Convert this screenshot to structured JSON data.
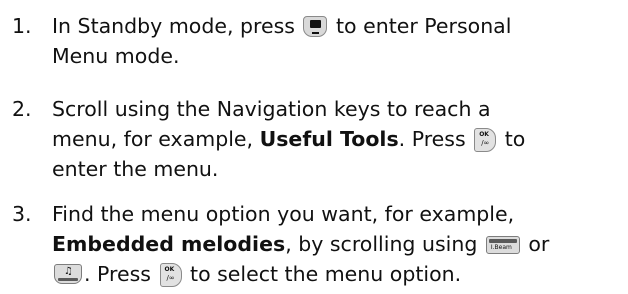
{
  "steps": [
    {
      "number": "1.",
      "line1_pre": "In Standby mode, press ",
      "line1_post": " to enter Personal",
      "line2": "Menu mode."
    },
    {
      "number": "2.",
      "line1": "Scroll using the Navigation keys to reach a",
      "line2_pre": "menu, for example, ",
      "line2_bold": "Useful Tools",
      "line2_mid": ". Press ",
      "line2_post": " to",
      "line3": "enter the menu."
    },
    {
      "number": "3.",
      "line1": "Find the menu option you want, for example,",
      "line2_bold": "Embedded melodies",
      "line2_post": ", by scrolling using ",
      "line2_end": " or",
      "line3_pre": ". Press ",
      "line3_post": " to select the menu option."
    }
  ],
  "icons": {
    "personal_menu_key": "personal-menu-key-icon",
    "ok_key": "ok-key-icon",
    "volume_key": "volume-key-icon",
    "music_key": "music-key-icon",
    "ok_key_label": "OK",
    "ok_key_sub": "/∞",
    "volume_key_label": "I.Beam",
    "music_key_label": "♫"
  }
}
